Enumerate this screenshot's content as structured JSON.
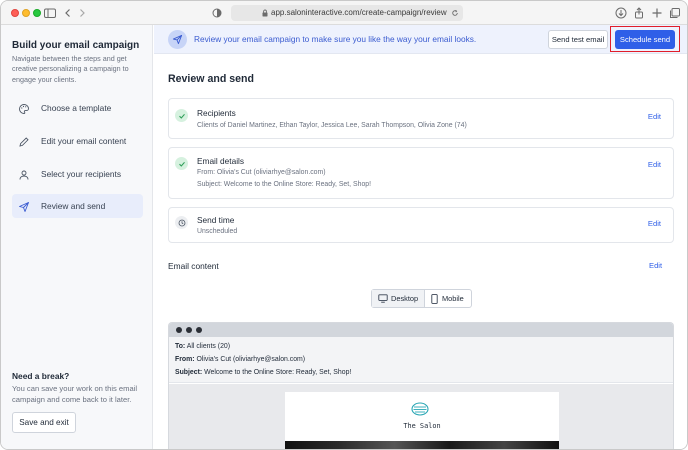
{
  "browser": {
    "url": "app.saloninteractive.com/create-campaign/review",
    "icons": [
      "sidebar-toggle-icon",
      "back-icon",
      "forward-icon",
      "shield-icon",
      "reload-icon",
      "download-icon",
      "share-icon",
      "new-tab-icon",
      "tabs-icon"
    ]
  },
  "sidebar": {
    "title": "Build your email campaign",
    "description": "Navigate between the steps and get creative personalizing a campaign to engage your clients.",
    "steps": [
      {
        "label": "Choose a template",
        "icon": "palette-icon",
        "active": false
      },
      {
        "label": "Edit your email content",
        "icon": "pen-icon",
        "active": false
      },
      {
        "label": "Select your recipients",
        "icon": "user-icon",
        "active": false
      },
      {
        "label": "Review and send",
        "icon": "send-icon",
        "active": true
      }
    ],
    "break_title": "Need a break?",
    "break_description": "You can save your work on this email campaign and come back to it later.",
    "save_exit_label": "Save and exit"
  },
  "banner": {
    "text": "Review your email campaign to make sure you like the way your email looks.",
    "send_test_label": "Send test email",
    "schedule_label": "Schedule send"
  },
  "main": {
    "title": "Review and send",
    "recipients": {
      "title": "Recipients",
      "detail": "Clients of Daniel Martinez, Ethan Taylor, Jessica Lee, Sarah Thompson, Olivia Zone (74)",
      "edit": "Edit"
    },
    "email_details": {
      "title": "Email details",
      "from": "From: Olivia's Cut (oliviarhye@salon.com)",
      "subject": "Subject: Welcome to the Online Store: Ready, Set, Shop!",
      "edit": "Edit"
    },
    "send_time": {
      "title": "Send time",
      "detail": "Unscheduled",
      "edit": "Edit"
    },
    "email_content": {
      "title": "Email content",
      "edit": "Edit",
      "desktop_label": "Desktop",
      "mobile_label": "Mobile"
    },
    "preview": {
      "to_label": "To:",
      "to_value": "All clients (20)",
      "from_label": "From:",
      "from_value": "Olivia's Cut (oliviarhye@salon.com)",
      "subject_label": "Subject:",
      "subject_value": "Welcome to the Online Store: Ready, Set, Shop!",
      "salon_name": "The Salon"
    }
  },
  "colors": {
    "accent": "#2f5fe8",
    "highlight_outline": "#e11d2a",
    "success": "#2f9e59"
  }
}
